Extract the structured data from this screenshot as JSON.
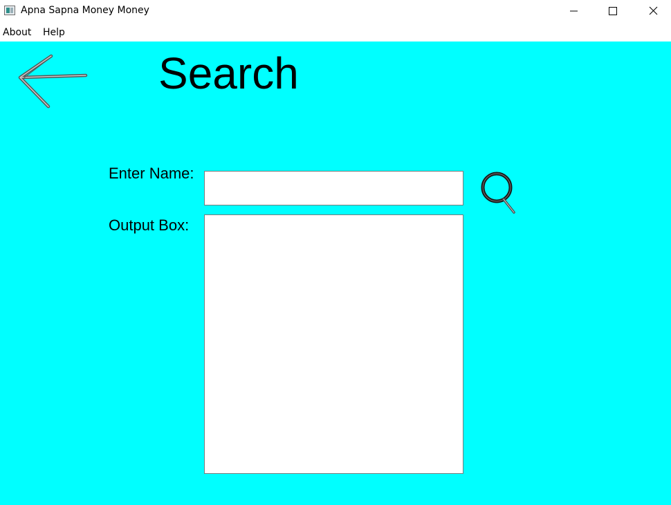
{
  "window": {
    "title": "Apna Sapna Money Money",
    "controls": {
      "minimize_icon": "minimize-icon",
      "maximize_icon": "maximize-icon",
      "close_icon": "close-icon"
    }
  },
  "menu": {
    "items": [
      {
        "label": "About"
      },
      {
        "label": "Help"
      }
    ]
  },
  "page": {
    "background_color": "#00ffff",
    "back_icon": "back-arrow-icon",
    "title": "Search",
    "name_label": "Enter Name:",
    "name_input_value": "",
    "output_label": "Output Box:",
    "output_value": "",
    "search_icon": "search-icon"
  }
}
